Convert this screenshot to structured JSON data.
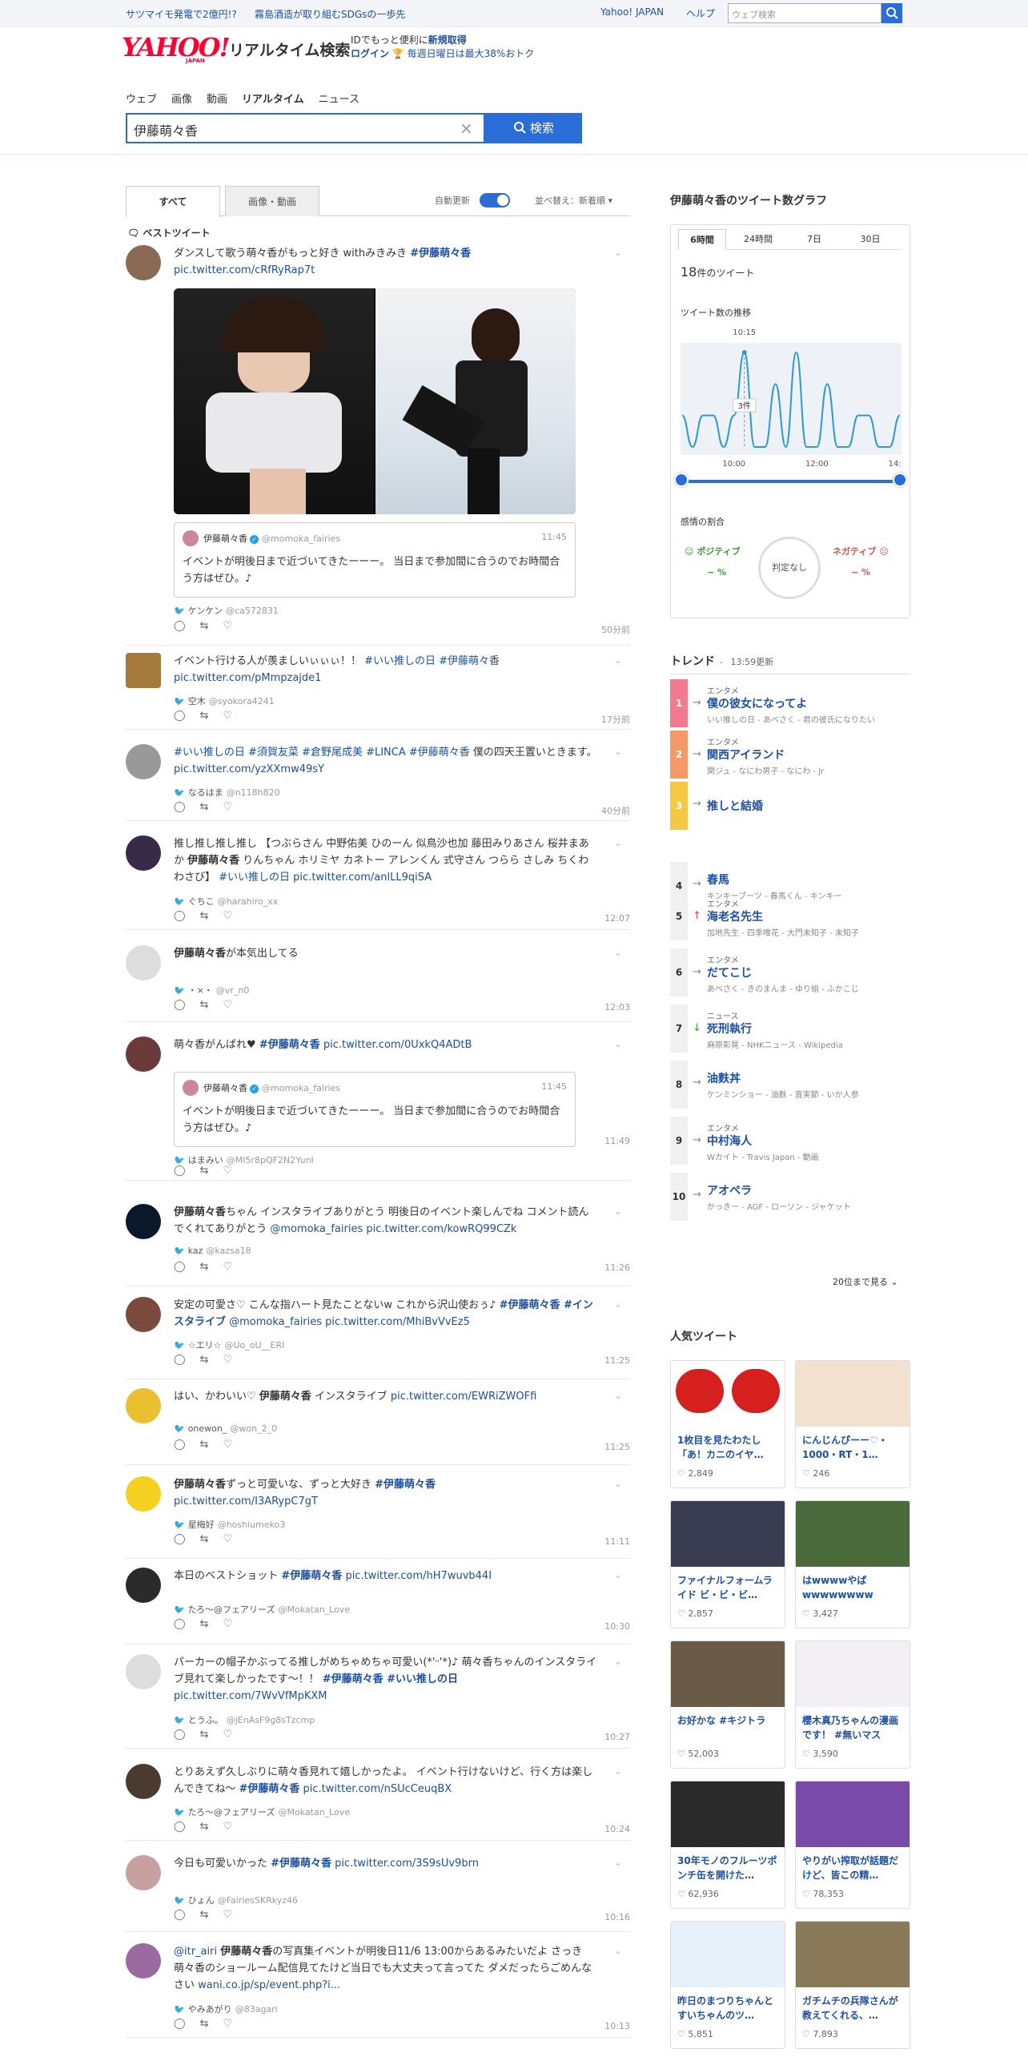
{
  "topbar": {
    "promo1": "サツマイモ発電で2億円!?",
    "promo2": "霧島酒造が取り組むSDGsの一歩先",
    "yahoo_japan": "Yahoo! JAPAN",
    "help": "ヘルプ",
    "search_placeholder": "ウェブ検索"
  },
  "header": {
    "logo": "YAHOO!",
    "logo_sub": "JAPAN",
    "service": "リアルタイム検索",
    "id_line1_a": "IDでもっと便利に",
    "id_line1_b": "新規取得",
    "login": "ログイン",
    "id_line2": "毎週日曜日は最大38%おトク"
  },
  "nav": [
    "ウェブ",
    "画像",
    "動画",
    "リアルタイム",
    "ニュース"
  ],
  "search": {
    "query": "伊藤萌々香",
    "button": "検索"
  },
  "tabs": {
    "all": "すべて",
    "media": "画像・動画",
    "auto_update": "自動更新",
    "sort": "並べ替え：新着順"
  },
  "best_label": "ベストツイート",
  "tweets": [
    {
      "text_a": "ダンスして歌う萌々香がもっと好き withみきみき ",
      "tag": "#伊藤萌々香",
      "link": "pic.twitter.com/cRfRyRap7t",
      "quote": {
        "name": "伊藤萌々香",
        "handle": "@momoka_fairies",
        "time": "11:45",
        "text": "イベントが明後日まで近づいてきたーーー。 当日まで参加間に合うのでお時間合う方はぜひ。♪"
      },
      "user": "ケンケン",
      "handle": "@ca572831",
      "time": "50分前"
    },
    {
      "text_a": "イベント行ける人が羨ましいぃぃぃ！！ ",
      "tag": "#いい推しの日 #伊藤萌々香",
      "link": "pic.twitter.com/pMmpzajde1",
      "user": "空木",
      "handle": "@syokora4241",
      "time": "17分前"
    },
    {
      "tags": "#いい推しの日 #須賀友菜 #倉野尾成美 #LINCA #伊藤萌々香",
      "text_a": " 僕の四天王置いときます。 ",
      "link": "pic.twitter.com/yzXXmw49sY",
      "user": "なるはま",
      "handle": "@n118h820",
      "time": "40分前"
    },
    {
      "text_a": "推し推し推し推し 【つぶらさん 中野佑美 ひのーん 似鳥沙也加 藤田みりあさん 桜井まあか ",
      "bold": "伊藤萌々香",
      "text_b": " りんちゃん ホリミヤ カネトー アレンくん 式守さん つらら さしみ ちくわ わさび】 ",
      "tag": "#いい推しの日",
      "link": " pic.twitter.com/anlLL9qiSA",
      "user": "ぐちこ",
      "handle": "@harahiro_xx",
      "time": "12:07"
    },
    {
      "bold": "伊藤萌々香",
      "text_a": "が本気出してる",
      "user": "・×・",
      "handle": "@vr_n0",
      "time": "12:03"
    },
    {
      "text_a": "萌々香がんばれ♥ ",
      "tag": "#伊藤萌々香",
      "link": " pic.twitter.com/0UxkQ4ADtB",
      "quote": {
        "name": "伊藤萌々香",
        "handle": "@momoka_fairies",
        "time": "11:45",
        "text": "イベントが明後日まで近づいてきたーーー。 当日まで参加間に合うのでお時間合う方はぜひ。♪"
      },
      "user": "はまみい",
      "handle": "@MI5r8pQF2N2YunI",
      "time": "11:49"
    },
    {
      "bold": "伊藤萌々香",
      "text_a": "ちゃん インスタライブありがとう 明後日のイベント楽しんでね コメント読んでくれてありがとう ",
      "link": "@momoka_fairies pic.twitter.com/kowRQ99CZk",
      "user": "kaz",
      "handle": "@kazsa18",
      "time": "11:26"
    },
    {
      "text_a": "安定の可愛さ♡ こんな指ハート見たことないw これから沢山使おぅ♪ ",
      "tag": "#伊藤萌々香 #インスタライブ",
      "link": " @momoka_fairies pic.twitter.com/MhiBvVvEz5",
      "user": "☆エリ☆",
      "handle": "@Uo_oU__ERI",
      "time": "11:25"
    },
    {
      "text_a": "はい、かわいい♡ ",
      "bold": "伊藤萌々香",
      "text_b": " インスタライブ ",
      "link": "pic.twitter.com/EWRiZWOFfi",
      "user": "onewon_",
      "handle": "@won_2_0",
      "time": "11:25"
    },
    {
      "bold": "伊藤萌々香",
      "text_a": "ずっと可愛いな、ずっと大好き ",
      "tag": "#伊藤萌々香",
      "link": "pic.twitter.com/I3ARypC7gT",
      "user": "星梅好",
      "handle": "@hoshiumeko3",
      "time": "11:11"
    },
    {
      "text_a": "本日のベストショット ",
      "tag": "#伊藤萌々香",
      "link": " pic.twitter.com/hH7wuvb44I",
      "user": "たろ〜@フェアリーズ",
      "handle": "@Mokatan_Love",
      "time": "10:30"
    },
    {
      "text_a": "パーカーの帽子かぶってる推しがめちゃめちゃ可愛い(*'ᵕ'*)♪ 萌々香ちゃんのインスタライブ見れて楽しかったです～！！ ",
      "tag": "#伊藤萌々香 #いい推しの日",
      "link": "pic.twitter.com/7WvVfMpKXM",
      "user": "とうふ。",
      "handle": "@jEnAsF9g8sTzcmp",
      "time": "10:27"
    },
    {
      "text_a": "とりあえず久しぶりに萌々香見れて嬉しかったよ。 イベント行けないけど、行く方は楽しんできてね〜 ",
      "tag": "#伊藤萌々香",
      "link": " pic.twitter.com/nSUcCeuqBX",
      "user": "たろ〜@フェアリーズ",
      "handle": "@Mokatan_Love",
      "time": "10:24"
    },
    {
      "text_a": "今日も可愛いかった ",
      "tag": "#伊藤萌々香",
      "link": " pic.twitter.com/3S9sUv9brn",
      "user": "ひょん",
      "handle": "@FairiesSKRkyz46",
      "time": "10:16"
    },
    {
      "text_pre": "@itr_airi ",
      "bold": "伊藤萌々香",
      "text_a": "の写真集イベントが明後日11/6 13:00からあるみたいだよ さっき萌々香のショールーム配信見てたけど当日でも大丈夫って言ってた ダメだったらごめんなさい ",
      "link": "wani.co.jp/sp/event.php?i...",
      "user": "やみあがり",
      "handle": "@83agari",
      "time": "10:13"
    }
  ],
  "graph": {
    "title": "伊藤萌々香のツイート数グラフ",
    "ranges": [
      "6時間",
      "24時間",
      "7日",
      "30日"
    ],
    "count": "18",
    "count_unit": "件のツイート",
    "trend_label": "ツイート数の推移",
    "peak_time": "10:15",
    "peak_label": "3件",
    "xticks": [
      "10:00",
      "12:00",
      "14:00"
    ],
    "sentiment_label": "感情の割合",
    "positive": "ポジティブ",
    "positive_value": "− %",
    "negative": "ネガティブ",
    "negative_value": "− %",
    "judge": "判定なし"
  },
  "chart_data": {
    "type": "line",
    "x": [
      "08:45",
      "09:00",
      "09:15",
      "09:30",
      "09:45",
      "10:00",
      "10:15",
      "10:30",
      "10:45",
      "11:00",
      "11:15",
      "11:30",
      "11:45",
      "12:00",
      "12:15",
      "12:30",
      "12:45",
      "13:00",
      "13:15",
      "13:30",
      "13:45",
      "14:00"
    ],
    "values": [
      1,
      0,
      1,
      1,
      0,
      1,
      3,
      0,
      0,
      2,
      0,
      3,
      0,
      0,
      2,
      0,
      0,
      1,
      1,
      0,
      0,
      1
    ],
    "xlabel": "",
    "ylabel": "",
    "ylim": [
      0,
      3
    ]
  },
  "trend": {
    "title": "トレンド",
    "updated": "13:59更新",
    "items": [
      {
        "rank": "1",
        "cat": "エンタメ",
        "title": "僕の彼女になってよ",
        "sub": "いい推しの日 - あべさく - 君の彼氏になりたい",
        "arrow": "→",
        "color": "#f37a8e"
      },
      {
        "rank": "2",
        "cat": "エンタメ",
        "title": "関西アイランド",
        "sub": "関ジュ - なにわ男子 - なにわ - Jr",
        "arrow": "→",
        "color": "#f59a66"
      },
      {
        "rank": "3",
        "cat": "",
        "title": "推しと結婚",
        "sub": "",
        "arrow": "→",
        "color": "#f5c842"
      },
      {
        "rank": "4",
        "cat": "",
        "title": "春馬",
        "sub": "キンキーブーツ - 春馬くん - キンキー",
        "arrow": "→",
        "color": "#f0f0f0"
      },
      {
        "rank": "5",
        "cat": "エンタメ",
        "title": "海老名先生",
        "sub": "加地先生 - 四季唯花 - 大門未知子 - 未知子",
        "arrow": "↑",
        "color": "#f0f0f0"
      },
      {
        "rank": "6",
        "cat": "エンタメ",
        "title": "だてこじ",
        "sub": "あべさく - きのまんま - ゆり組 - ふかこじ",
        "arrow": "→",
        "color": "#f0f0f0"
      },
      {
        "rank": "7",
        "cat": "ニュース",
        "title": "死刑執行",
        "sub": "麻原彰晃 - NHKニュース - Wikipedia",
        "arrow": "↓",
        "color": "#f0f0f0"
      },
      {
        "rank": "8",
        "cat": "",
        "title": "油麩丼",
        "sub": "ケンミンショー - 油麩 - 直実節 - いか人参",
        "arrow": "→",
        "color": "#f0f0f0"
      },
      {
        "rank": "9",
        "cat": "エンタメ",
        "title": "中村海人",
        "sub": "Wカイト - Travis Japan - 動画",
        "arrow": "→",
        "color": "#f0f0f0"
      },
      {
        "rank": "10",
        "cat": "",
        "title": "アオペラ",
        "sub": "かっきー - AGF - ローソン - ジャケット",
        "arrow": "→",
        "color": "#f0f0f0"
      }
    ],
    "more": "20位まで見る"
  },
  "popular": {
    "title": "人気ツイート",
    "cards": [
      {
        "title": "1枚目を見たわたし「あ！カニのイヤ…",
        "likes": "2,849",
        "color": "#ffffff"
      },
      {
        "title": "にんじんぴーー♡・1000・RT・1…",
        "likes": "246",
        "color": "#f4e2d0"
      },
      {
        "title": "ファイナルフォームライド ビ・ビ・ビ…",
        "likes": "2,857",
        "color": "#3a3d52"
      },
      {
        "title": "はwwwwやばwwwwwwww",
        "likes": "3,427",
        "color": "#4b6a3c"
      },
      {
        "title": "お好かな #キジトラ",
        "likes": "52,003",
        "color": "#6a5a48"
      },
      {
        "title": "櫻木真乃ちゃんの漫画です！ #無いマス",
        "likes": "3,590",
        "color": "#f3f0f5"
      },
      {
        "title": "30年モノのフルーツポンチ缶を開けた…",
        "likes": "62,936",
        "color": "#2a2a2a"
      },
      {
        "title": "やりがい搾取が話題だけど、皆この精…",
        "likes": "78,353",
        "color": "#7a4aa8"
      },
      {
        "title": "昨日のまつりちゃんとすいちゃんのツ…",
        "likes": "5,851",
        "color": "#e6f0f8"
      },
      {
        "title": "ガチムチの兵隊さんが教えてくれる、…",
        "likes": "7,893",
        "color": "#8a7a5a"
      }
    ]
  }
}
